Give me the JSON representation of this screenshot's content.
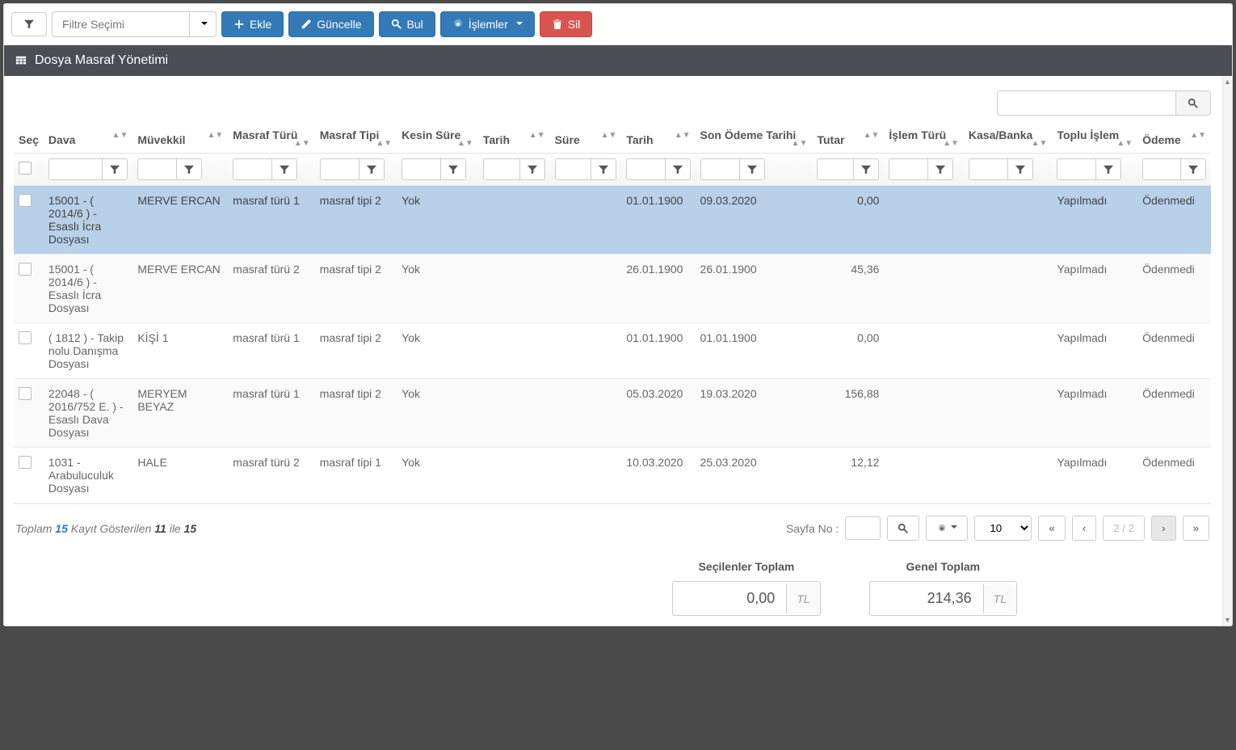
{
  "toolbar": {
    "filter_placeholder": "Filtre Seçimi",
    "add": "Ekle",
    "update": "Güncelle",
    "find": "Bul",
    "ops": "İşlemler",
    "delete": "Sil"
  },
  "panel_title": "Dosya Masraf Yönetimi",
  "columns": {
    "sec": "Seç",
    "dava": "Dava",
    "muvekkil": "Müvekkil",
    "masraf_turu": "Masraf Türü",
    "masraf_tipi": "Masraf Tipi",
    "kesin_sure": "Kesin Süre",
    "tarih1": "Tarih",
    "sure": "Süre",
    "tarih2": "Tarih",
    "son_odeme": "Son Ödeme Tarihi",
    "tutar": "Tutar",
    "islem_turu": "İşlem Türü",
    "kasa": "Kasa/Banka",
    "toplu": "Toplu İşlem",
    "odeme": "Ödeme"
  },
  "rows": [
    {
      "dava": "15001 - ( 2014/6 ) - Esaslı İcra Dosyası",
      "muvekkil": "MERVE ERCAN",
      "mturu": "masraf türü 1",
      "mtipi": "masraf tipi 2",
      "kesin": "Yok",
      "t1": "",
      "sure": "",
      "t2": "01.01.1900",
      "son": "09.03.2020",
      "tutar": "0,00",
      "islem": "",
      "kasa": "",
      "toplu": "Yapılmadı",
      "odeme": "Ödenmedi",
      "selected": true
    },
    {
      "dava": "15001 - ( 2014/6 ) - Esaslı İcra Dosyası",
      "muvekkil": "MERVE ERCAN",
      "mturu": "masraf türü 2",
      "mtipi": "masraf tipi 2",
      "kesin": "Yok",
      "t1": "",
      "sure": "",
      "t2": "26.01.1900",
      "son": "26.01.1900",
      "tutar": "45,36",
      "islem": "",
      "kasa": "",
      "toplu": "Yapılmadı",
      "odeme": "Ödenmedi"
    },
    {
      "dava": "( 1812 ) - Takip nolu Danışma Dosyası",
      "muvekkil": "KİŞİ 1",
      "mturu": "masraf türü 1",
      "mtipi": "masraf tipi 2",
      "kesin": "Yok",
      "t1": "",
      "sure": "",
      "t2": "01.01.1900",
      "son": "01.01.1900",
      "tutar": "0,00",
      "islem": "",
      "kasa": "",
      "toplu": "Yapılmadı",
      "odeme": "Ödenmedi"
    },
    {
      "dava": "22048 - ( 2016/752 E. ) - Esaslı Dava Dosyası",
      "muvekkil": "MERYEM BEYAZ",
      "mturu": "masraf türü 1",
      "mtipi": "masraf tipi 2",
      "kesin": "Yok",
      "t1": "",
      "sure": "",
      "t2": "05.03.2020",
      "son": "19.03.2020",
      "tutar": "156,88",
      "islem": "",
      "kasa": "",
      "toplu": "Yapılmadı",
      "odeme": "Ödenmedi"
    },
    {
      "dava": "1031 - Arabuluculuk Dosyası",
      "muvekkil": "HALE",
      "mturu": "masraf türü 2",
      "mtipi": "masraf tipi 1",
      "kesin": "Yok",
      "t1": "",
      "sure": "",
      "t2": "10.03.2020",
      "son": "25.03.2020",
      "tutar": "12,12",
      "islem": "",
      "kasa": "",
      "toplu": "Yapılmadı",
      "odeme": "Ödenmedi"
    }
  ],
  "footer": {
    "toplam_label": "Toplam",
    "toplam_count": "15",
    "gosterilen_label": "Kayıt Gösterilen",
    "from": "11",
    "ile": "ile",
    "to": "15",
    "sayfa_label": "Sayfa No :",
    "page_indicator": "2 / 2",
    "page_size": "10"
  },
  "totals": {
    "selected_label": "Seçilenler Toplam",
    "selected_value": "0,00",
    "selected_currency": "TL",
    "grand_label": "Genel Toplam",
    "grand_value": "214,36",
    "grand_currency": "TL"
  }
}
